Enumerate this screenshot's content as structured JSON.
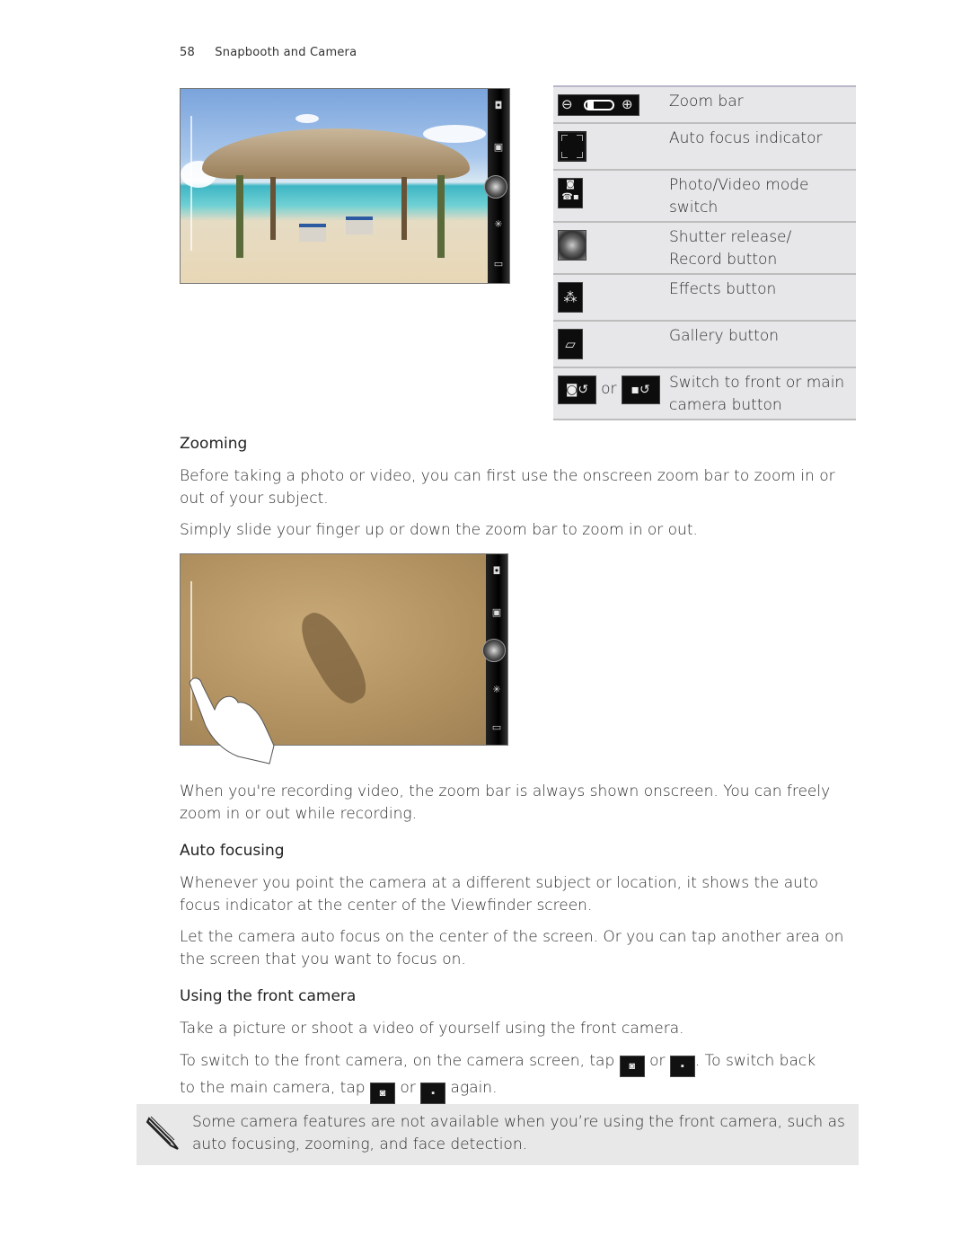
{
  "header": {
    "page_number": "58",
    "chapter": "Snapbooth and Camera"
  },
  "legend": {
    "rows": [
      {
        "icon": "zoom-bar-icon",
        "label": "Zoom bar"
      },
      {
        "icon": "auto-focus-indicator-icon",
        "label": "Auto focus indicator"
      },
      {
        "icon": "photo-video-mode-switch-icon",
        "label": "Photo/Video mode switch"
      },
      {
        "icon": "shutter-release-icon",
        "label": "Shutter release/ Record button"
      },
      {
        "icon": "effects-wand-icon",
        "label": "Effects button"
      },
      {
        "icon": "gallery-icon",
        "label": "Gallery button"
      },
      {
        "icon": "switch-camera-icon",
        "or_text": "or",
        "label": "Switch to front or main camera button"
      }
    ]
  },
  "sections": {
    "zooming": {
      "heading": "Zooming",
      "p1": "Before taking a photo or video, you can first use the onscreen zoom bar to zoom in or out of your subject.",
      "p2": "Simply slide your finger up or down the zoom bar to zoom in or out.",
      "p3": "When you're recording video, the zoom bar is always shown onscreen. You can freely zoom in or out while recording."
    },
    "auto_focusing": {
      "heading": "Auto focusing",
      "p1": "Whenever you point the camera at a different subject or location, it shows the auto focus indicator at the center of the Viewfinder screen.",
      "p2": "Let the camera auto focus on the center of the screen. Or you can tap another area on the screen that you want to focus on."
    },
    "front_camera": {
      "heading": "Using the front camera",
      "p1": "Take a picture or shoot a video of yourself using the front camera.",
      "p2_a": "To switch to the front camera, on the camera screen, tap",
      "p2_or": "or",
      "p2_b": ". To switch back",
      "p2_c": "to the main camera, tap",
      "p2_or2": "or",
      "p2_d": "again."
    }
  },
  "note": {
    "icon": "pencil-note-icon",
    "text": "Some camera features are not available when you’re using the front camera, such as auto focusing, zooming, and face detection."
  }
}
